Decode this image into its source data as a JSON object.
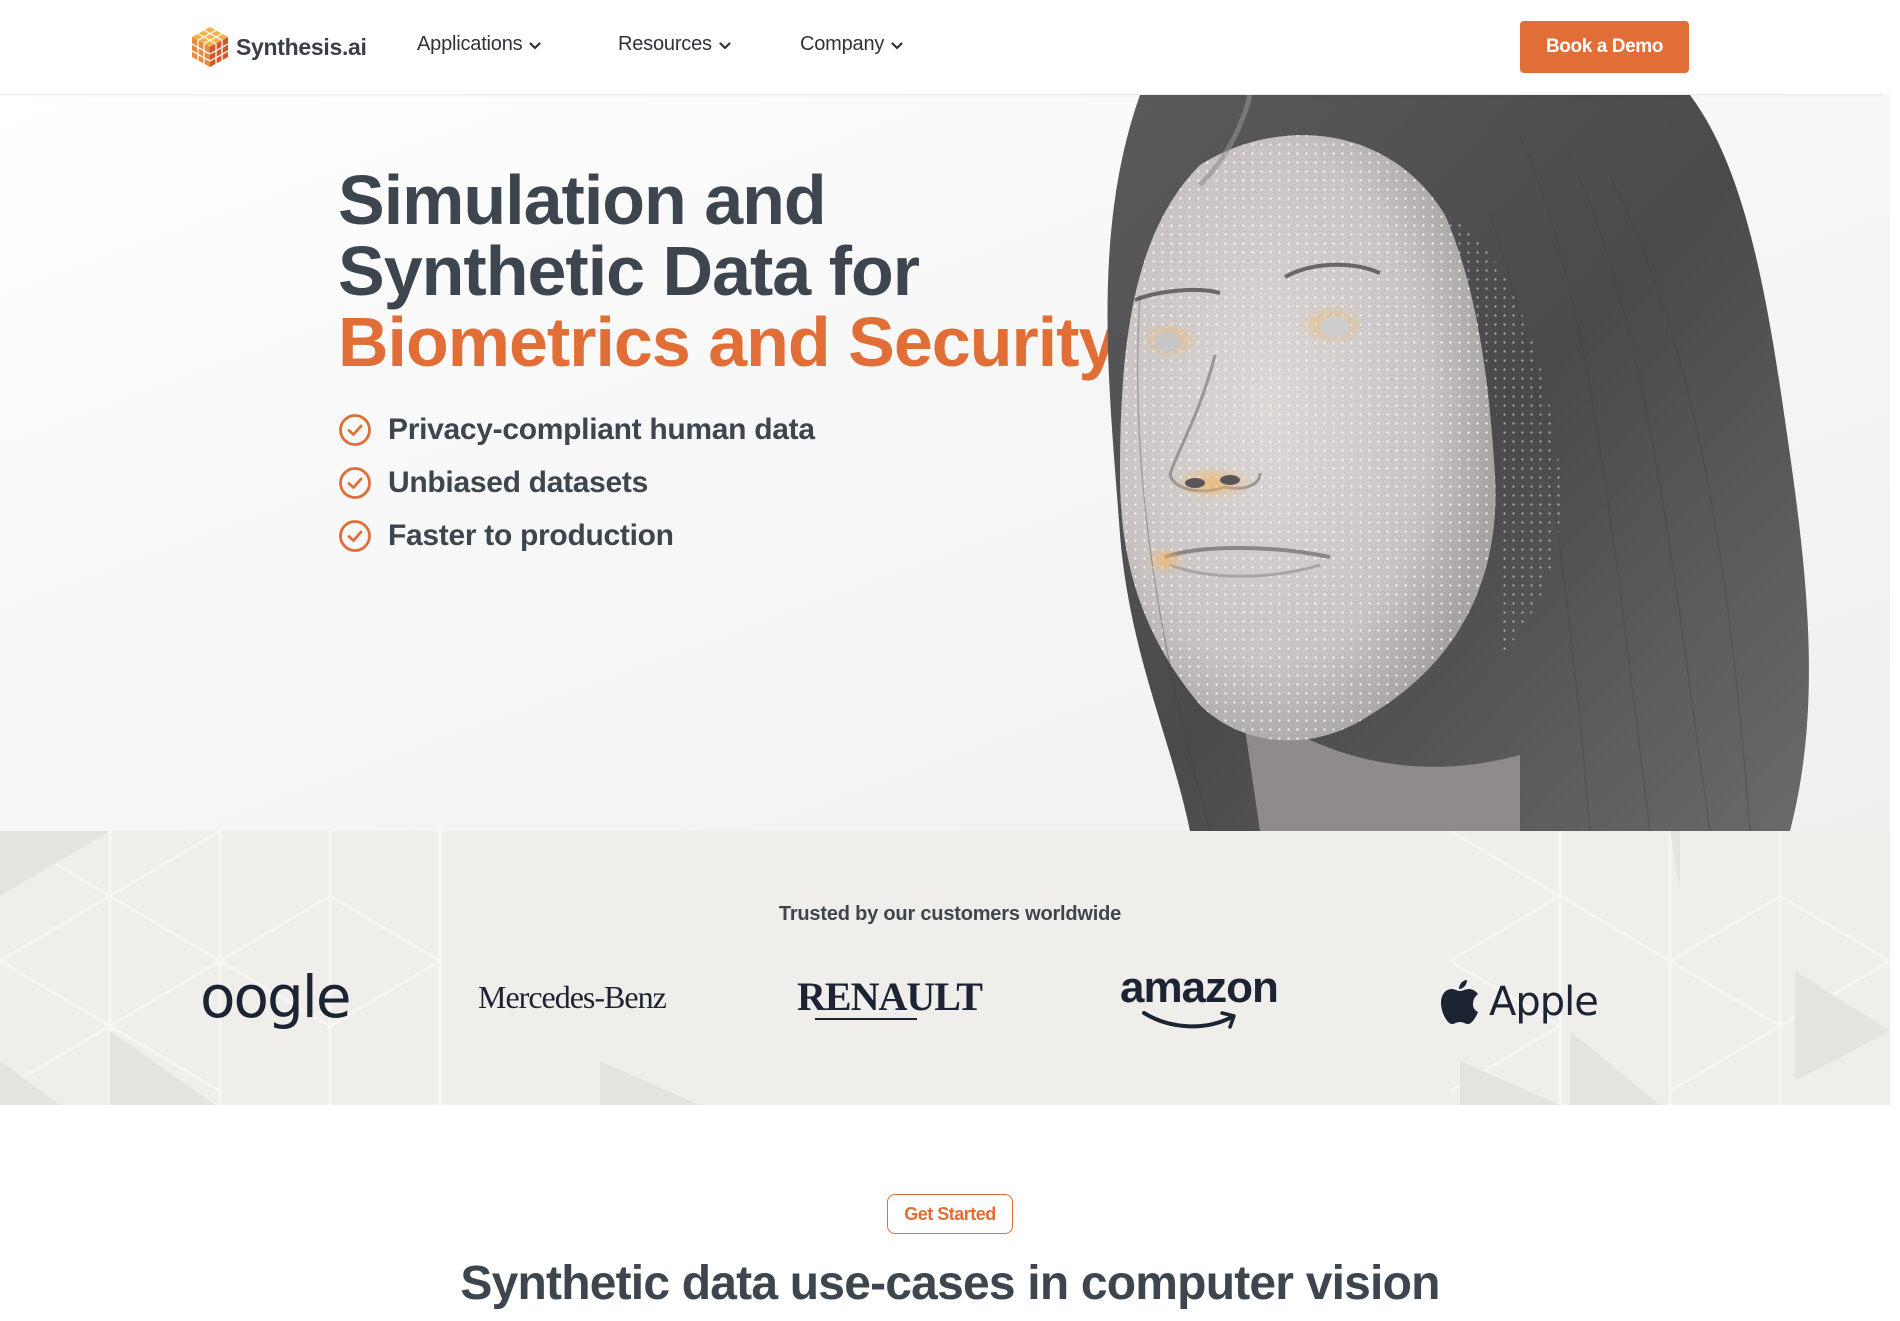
{
  "header": {
    "logo_text": "Synthesis.ai",
    "logo_icon": "cube-grid-logo-icon",
    "nav": [
      {
        "label": "Applications",
        "icon": "chevron-down-icon"
      },
      {
        "label": "Resources",
        "icon": "chevron-down-icon"
      },
      {
        "label": "Company",
        "icon": "chevron-down-icon"
      }
    ],
    "cta_label": "Book a Demo"
  },
  "hero": {
    "title_line1": "Simulation and",
    "title_line2": "Synthetic Data for",
    "title_accent": "Biometrics and Security",
    "features": [
      {
        "icon": "check-circle-icon",
        "label": "Privacy-compliant human data"
      },
      {
        "icon": "check-circle-icon",
        "label": "Unbiased datasets"
      },
      {
        "icon": "check-circle-icon",
        "label": "Faster to production"
      }
    ],
    "image_description": "synthetic face with dot-mesh overlay"
  },
  "customers": {
    "heading": "Trusted by our customers worldwide",
    "brands": [
      {
        "name": "Google",
        "visible_text": "oogle"
      },
      {
        "name": "Mercedes-Benz",
        "visible_text": "Mercedes-Benz"
      },
      {
        "name": "Renault",
        "visible_text": "RENAULT"
      },
      {
        "name": "Amazon",
        "visible_text": "amazon"
      },
      {
        "name": "Apple",
        "visible_text": "Apple"
      }
    ]
  },
  "use_cases": {
    "button_label": "Get Started",
    "title": "Synthetic data use-cases in computer vision"
  },
  "colors": {
    "accent": "#e06e36",
    "text_dark": "#3d464e",
    "band_bg": "#efeeeb",
    "brand_logo": "#1c2433"
  }
}
